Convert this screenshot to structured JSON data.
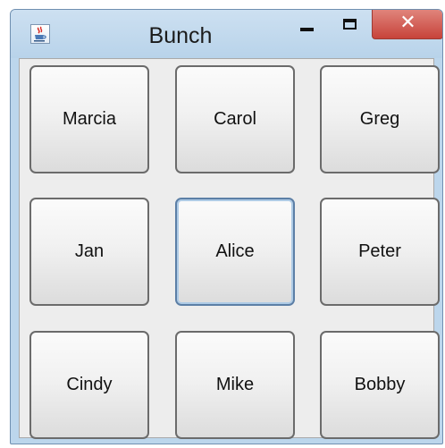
{
  "window": {
    "title": "Bunch",
    "controls": {
      "minimize_icon": "minimize-icon",
      "maximize_icon": "maximize-icon",
      "close_glyph": "✕"
    },
    "app_icon": "java-cup-icon",
    "close_color": "#c7433a",
    "titlebar_color": "#bcd6ec"
  },
  "buttons": [
    {
      "label": "Marcia"
    },
    {
      "label": "Carol"
    },
    {
      "label": "Greg"
    },
    {
      "label": "Jan"
    },
    {
      "label": "Alice",
      "focused": true
    },
    {
      "label": "Peter"
    },
    {
      "label": "Cindy"
    },
    {
      "label": "Mike"
    },
    {
      "label": "Bobby"
    }
  ]
}
